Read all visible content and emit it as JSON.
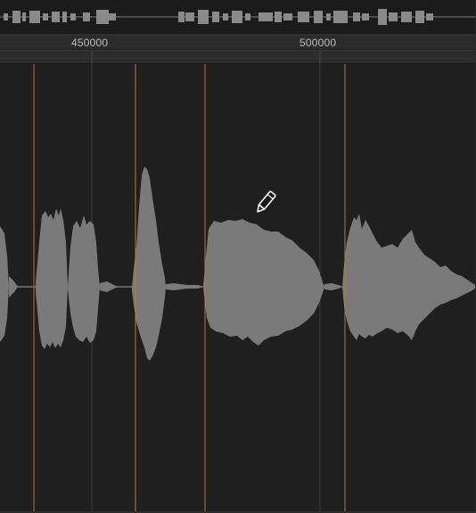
{
  "ruler": {
    "markers": [
      "450000",
      "500000"
    ]
  },
  "cursor": {
    "icon": "pencil-icon"
  },
  "colors": {
    "background": "#1f1f1f",
    "waveform": "#7a7a7a",
    "overview_waveform": "#8a8a8a",
    "transient_marker": "#b87a3c",
    "grid_line": "#3a3a3a"
  }
}
